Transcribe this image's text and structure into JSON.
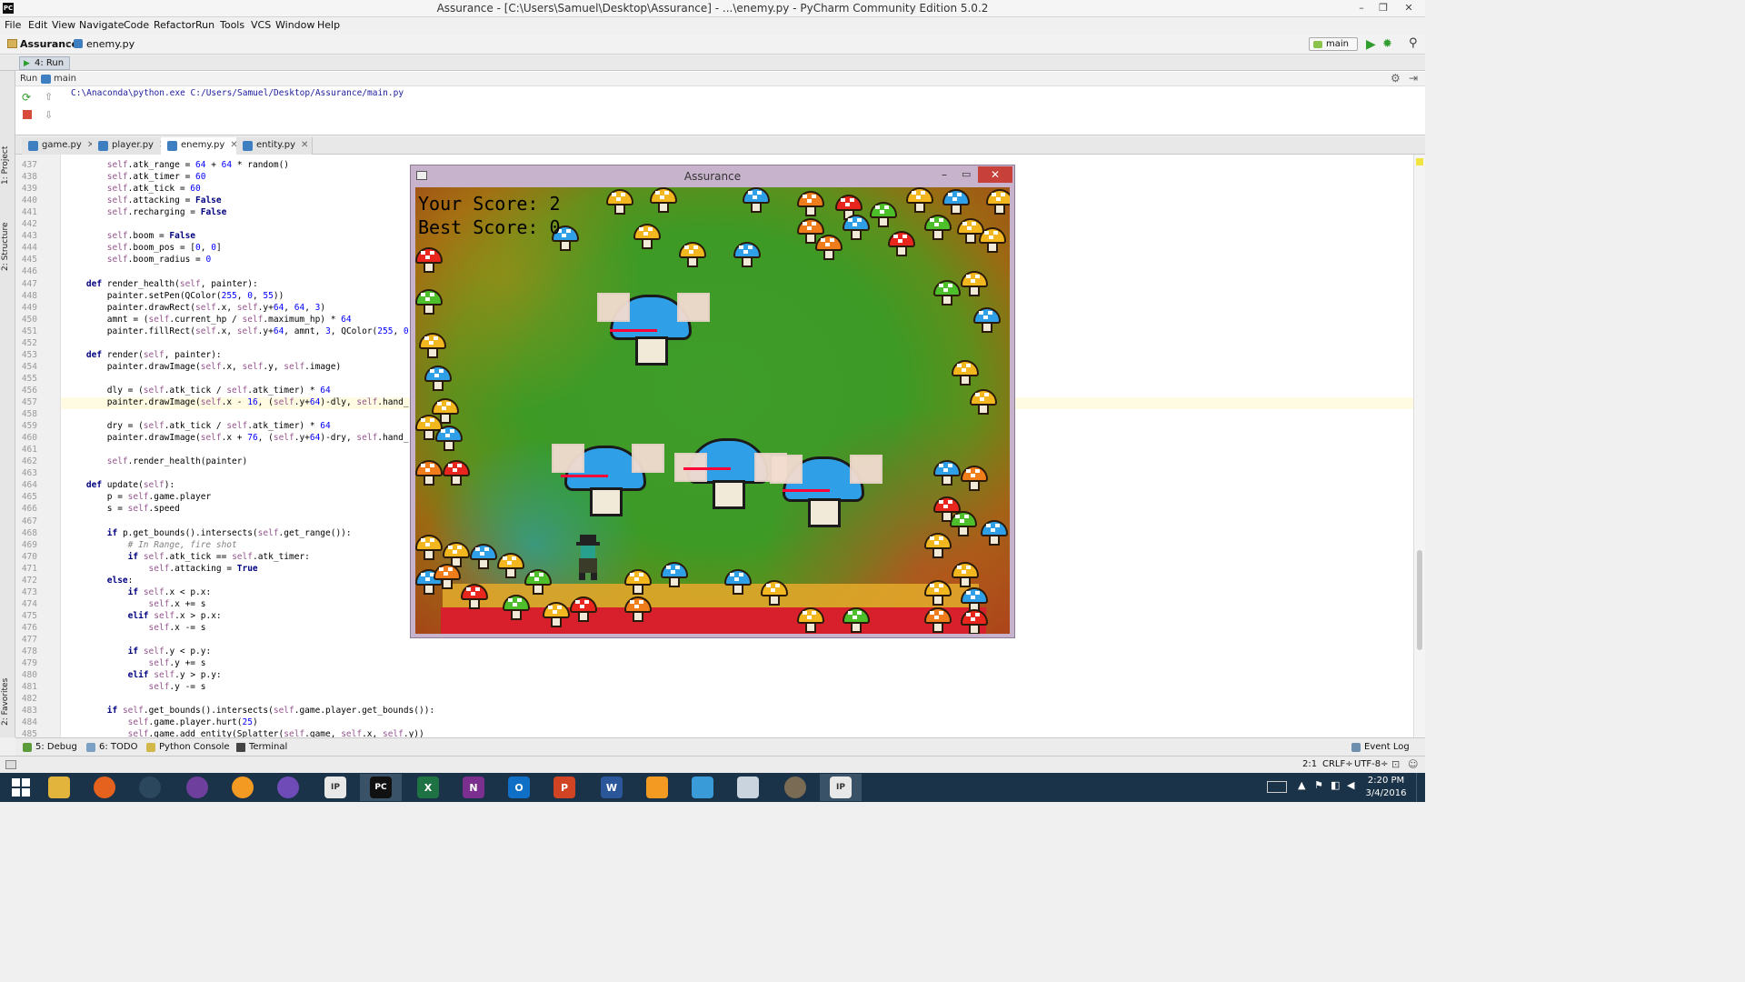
{
  "window": {
    "title": "Assurance - [C:\\Users\\Samuel\\Desktop\\Assurance] - ...\\enemy.py - PyCharm Community Edition 5.0.2",
    "app_icon_label": "PC",
    "controls": [
      "–",
      "❐",
      "✕"
    ]
  },
  "menu": [
    "File",
    "Edit",
    "View",
    "Navigate",
    "Code",
    "Refactor",
    "Run",
    "Tools",
    "VCS",
    "Window",
    "Help"
  ],
  "navbar": {
    "breadcrumb": [
      "Assurance",
      "enemy.py"
    ],
    "run_config": "main"
  },
  "toolwindow_tab": "4: Run",
  "run": {
    "label": "Run",
    "config": "main",
    "output": "C:\\Anaconda\\python.exe C:/Users/Samuel/Desktop/Assurance/main.py"
  },
  "left_strip": [
    "1: Project",
    "2: Structure",
    "2: Favorites"
  ],
  "editor_tabs": [
    {
      "label": "game.py",
      "active": false
    },
    {
      "label": "player.py",
      "active": false
    },
    {
      "label": "enemy.py",
      "active": true
    },
    {
      "label": "entity.py",
      "active": false
    }
  ],
  "code_lines": [
    {
      "n": "437",
      "text": "        self.atk_range = 64 + 64 * random()"
    },
    {
      "n": "438",
      "text": "        self.atk_timer = 60"
    },
    {
      "n": "439",
      "text": "        self.atk_tick = 60"
    },
    {
      "n": "440",
      "text": "        self.attacking = False"
    },
    {
      "n": "441",
      "text": "        self.recharging = False"
    },
    {
      "n": "442",
      "text": ""
    },
    {
      "n": "443",
      "text": "        self.boom = False"
    },
    {
      "n": "444",
      "text": "        self.boom_pos = [0, 0]"
    },
    {
      "n": "445",
      "text": "        self.boom_radius = 0"
    },
    {
      "n": "446",
      "text": ""
    },
    {
      "n": "447",
      "text": "    def render_health(self, painter):"
    },
    {
      "n": "448",
      "text": "        painter.setPen(QColor(255, 0, 55))"
    },
    {
      "n": "449",
      "text": "        painter.drawRect(self.x, self.y+64, 64, 3)"
    },
    {
      "n": "450",
      "text": "        amnt = (self.current_hp / self.maximum_hp) * 64"
    },
    {
      "n": "451",
      "text": "        painter.fillRect(self.x, self.y+64, amnt, 3, QColor(255, 0"
    },
    {
      "n": "452",
      "text": ""
    },
    {
      "n": "453",
      "text": "    def render(self, painter):"
    },
    {
      "n": "454",
      "text": "        painter.drawImage(self.x, self.y, self.image)"
    },
    {
      "n": "455",
      "text": ""
    },
    {
      "n": "456",
      "text": "        dly = (self.atk_tick / self.atk_timer) * 64"
    },
    {
      "n": "457",
      "text": "        painter.drawImage(self.x - 16, (self.y+64)-dly, self.hand_"
    },
    {
      "n": "458",
      "text": ""
    },
    {
      "n": "459",
      "text": "        dry = (self.atk_tick / self.atk_timer) * 64"
    },
    {
      "n": "460",
      "text": "        painter.drawImage(self.x + 76, (self.y+64)-dry, self.hand_"
    },
    {
      "n": "461",
      "text": ""
    },
    {
      "n": "462",
      "text": "        self.render_health(painter)"
    },
    {
      "n": "463",
      "text": ""
    },
    {
      "n": "464",
      "text": "    def update(self):"
    },
    {
      "n": "465",
      "text": "        p = self.game.player"
    },
    {
      "n": "466",
      "text": "        s = self.speed"
    },
    {
      "n": "467",
      "text": ""
    },
    {
      "n": "468",
      "text": "        if p.get_bounds().intersects(self.get_range()):"
    },
    {
      "n": "469",
      "text": "            # In Range, fire shot"
    },
    {
      "n": "470",
      "text": "            if self.atk_tick == self.atk_timer:"
    },
    {
      "n": "471",
      "text": "                self.attacking = True"
    },
    {
      "n": "472",
      "text": "        else:"
    },
    {
      "n": "473",
      "text": "            if self.x < p.x:"
    },
    {
      "n": "474",
      "text": "                self.x += s"
    },
    {
      "n": "475",
      "text": "            elif self.x > p.x:"
    },
    {
      "n": "476",
      "text": "                self.x -= s"
    },
    {
      "n": "477",
      "text": ""
    },
    {
      "n": "478",
      "text": "            if self.y < p.y:"
    },
    {
      "n": "479",
      "text": "                self.y += s"
    },
    {
      "n": "480",
      "text": "            elif self.y > p.y:"
    },
    {
      "n": "481",
      "text": "                self.y -= s"
    },
    {
      "n": "482",
      "text": ""
    },
    {
      "n": "483",
      "text": "        if self.get_bounds().intersects(self.game.player.get_bounds()):"
    },
    {
      "n": "484",
      "text": "            self.game.player.hurt(25)"
    },
    {
      "n": "485",
      "text": "            self.game.add_entity(Splatter(self.game, self.x, self.y))"
    }
  ],
  "game": {
    "title": "Assurance",
    "score_label": "Your Score: 2",
    "best_label": "Best Score: 0"
  },
  "bottom_tools": [
    "5: Debug",
    "6: TODO",
    "Python Console",
    "Terminal",
    "Event Log"
  ],
  "status": {
    "position": "2:1",
    "line_sep": "CRLF÷",
    "encoding": "UTF-8÷"
  },
  "taskbar": {
    "time": "2:20 PM",
    "date": "3/4/2016"
  },
  "colors": {
    "keyword": "#000080",
    "self": "#94558d",
    "number": "#0000ff",
    "comment": "#808080",
    "enemy_cap": "#2fa0e8",
    "health_bar": "#ff0037",
    "taskbar": "#1b3348"
  }
}
